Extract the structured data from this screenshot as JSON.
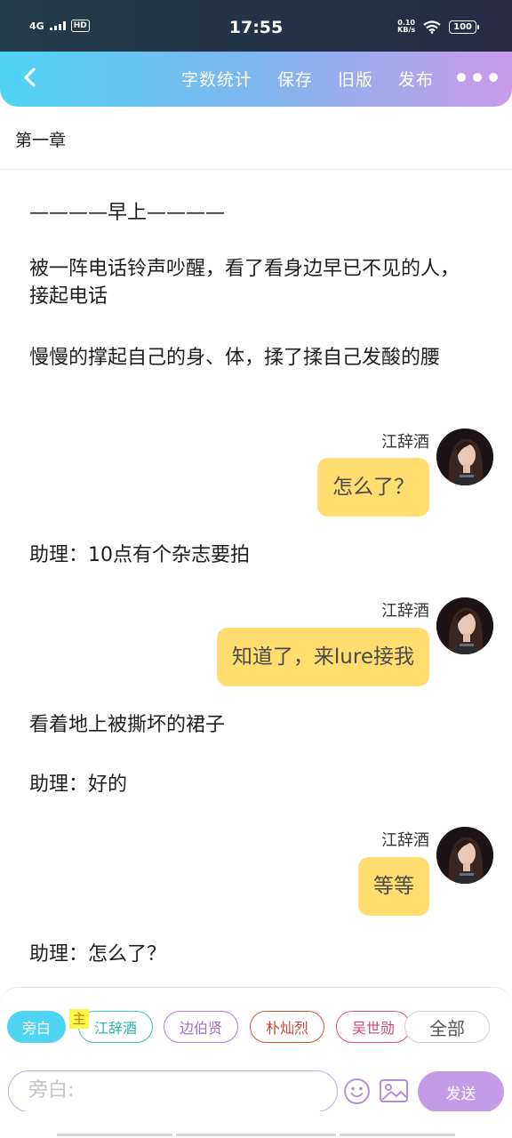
{
  "status_bar": {
    "network": "4G",
    "hd": "HD",
    "time": "17:55",
    "net_speed_value": "0.10",
    "net_speed_unit": "KB/s",
    "battery": "100"
  },
  "nav": {
    "actions": [
      "字数统计",
      "保存",
      "旧版",
      "发布"
    ]
  },
  "chapter": {
    "title": "第一章"
  },
  "story": [
    {
      "type": "narration",
      "text": "————早上————"
    },
    {
      "type": "narration",
      "text": "被一阵电话铃声吵醒，看了看身边早已不见的人，接起电话"
    },
    {
      "type": "narration",
      "text": "慢慢的撑起自己的身、体，揉了揉自己发酸的腰"
    },
    {
      "type": "dialogue",
      "speaker": "江辞酒",
      "text": "怎么了？"
    },
    {
      "type": "narration",
      "text": "助理：10点有个杂志要拍"
    },
    {
      "type": "dialogue",
      "speaker": "江辞酒",
      "text": "知道了，来lure接我"
    },
    {
      "type": "narration",
      "text": "看着地上被撕坏的裙子"
    },
    {
      "type": "narration",
      "text": "助理：好的"
    },
    {
      "type": "dialogue",
      "speaker": "江辞酒",
      "text": "等等"
    },
    {
      "type": "narration",
      "text": "助理：怎么了？"
    }
  ],
  "roles": {
    "narrator": "旁白",
    "main_tag": "主",
    "characters": [
      "江辞酒",
      "边伯贤",
      "朴灿烈",
      "吴世勋"
    ],
    "all": "全部"
  },
  "composer": {
    "placeholder": "旁白:",
    "send_label": "发送"
  },
  "colors": {
    "nav_gradient_start": "#4fd4f4",
    "nav_gradient_end": "#c99be8",
    "bubble": "#ffdd6e",
    "send_button": "#c39be6"
  }
}
